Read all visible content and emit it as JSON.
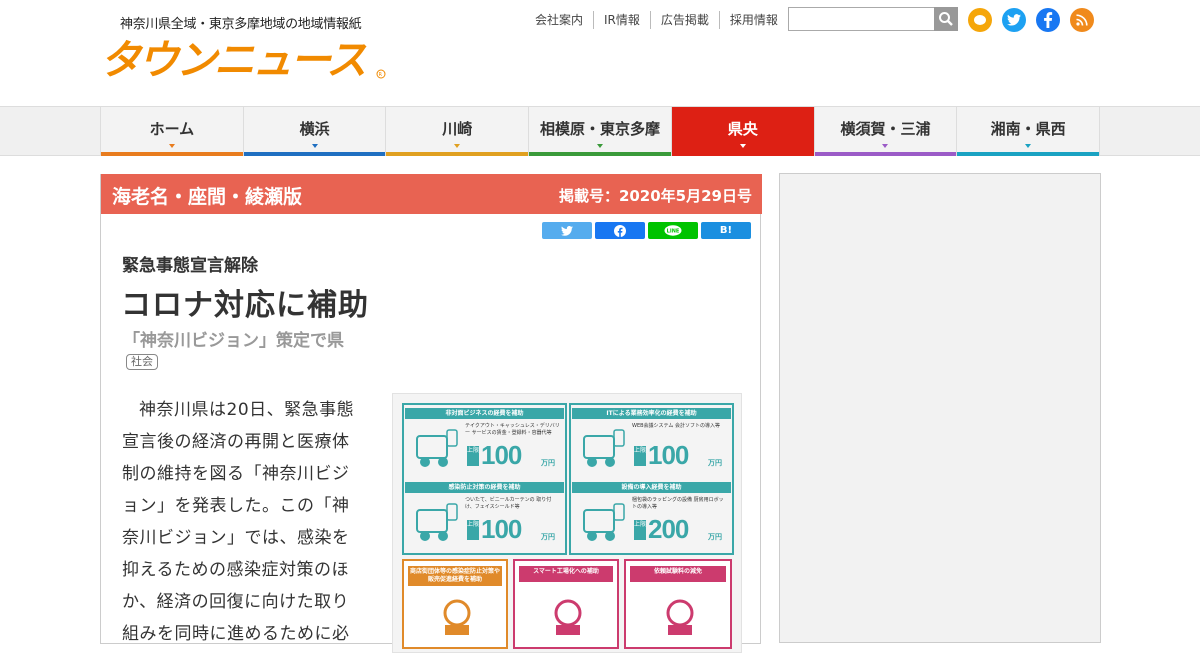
{
  "header": {
    "tagline": "神奈川県全域・東京多摩地域の地域情報紙",
    "logo_text": "タウンニュース",
    "links": [
      "会社案内",
      "IR情報",
      "広告掲載",
      "採用情報"
    ],
    "search_placeholder": ""
  },
  "nav": [
    {
      "label": "ホーム",
      "color": "#e87c1e",
      "active": false
    },
    {
      "label": "横浜",
      "color": "#1f6fc1",
      "active": false
    },
    {
      "label": "川崎",
      "color": "#e0a020",
      "active": false
    },
    {
      "label": "相模原・東京多摩",
      "color": "#3a9a3a",
      "active": false
    },
    {
      "label": "県央",
      "color": "#dd2014",
      "active": true
    },
    {
      "label": "横須賀・三浦",
      "color": "#9b5bc7",
      "active": false
    },
    {
      "label": "湘南・県西",
      "color": "#1aa2c2",
      "active": false
    }
  ],
  "article": {
    "edition": "海老名・座間・綾瀬版",
    "pubdate": "掲載号：2020年5月29日号",
    "kicker": "緊急事態宣言解除",
    "title": "コロナ対応に補助",
    "subtitle": "「神奈川ビジョン」策定で県",
    "tag": "社会",
    "body": "神奈川県は20日、緊急事態宣言後の経済の再開と医療体制の維持を図る「神奈川ビジョン」を発表した。この「神奈川ビジョン」では、感染を抑えるための感染症対策のほか、経済の回復に向けた取り組みを同時に進めるために必",
    "share": {
      "line": "LINE",
      "hatena": "B!"
    }
  },
  "infographic": {
    "cards": [
      {
        "head": "非対面ビジネスの経費を補助",
        "desc": "テイクアウト・キャッシュレス・デリバリー サービスの賃金・登録料・容器代等",
        "amount": "100",
        "jo": "上限",
        "unit": "万円"
      },
      {
        "head": "ITによる業務効率化の経費を補助",
        "desc": "WEB会議システム 会計ソフトの導入等",
        "amount": "100",
        "jo": "上限",
        "unit": "万円"
      },
      {
        "head": "感染防止対策の経費を補助",
        "desc": "ついたて、ビニールカーテンの 取り付け、フェイスシールド等",
        "amount": "100",
        "jo": "上限",
        "unit": "万円"
      },
      {
        "head": "設備の導入経費を補助",
        "desc": "梱包袋のラッピングの設備 厨房用ロボットの導入等",
        "amount": "200",
        "jo": "上限",
        "unit": "万円"
      }
    ],
    "bottom": [
      {
        "head": "商店街団体等の感染症防止対策や販売促進経費を補助",
        "color": "#e08a2a"
      },
      {
        "head": "スマート工場化への補助",
        "color": "#cc3b6e"
      },
      {
        "head": "依頼試験料の減免",
        "color": "#cc3b6e"
      }
    ]
  },
  "colors": {
    "accent": "#e86352",
    "teal": "#3aa7a8"
  },
  "icons": {
    "twitter": "#1da1f2",
    "facebook": "#1877f2",
    "line": "#00c300",
    "rss": "#f08a1c",
    "contact": "#f5a60a"
  }
}
